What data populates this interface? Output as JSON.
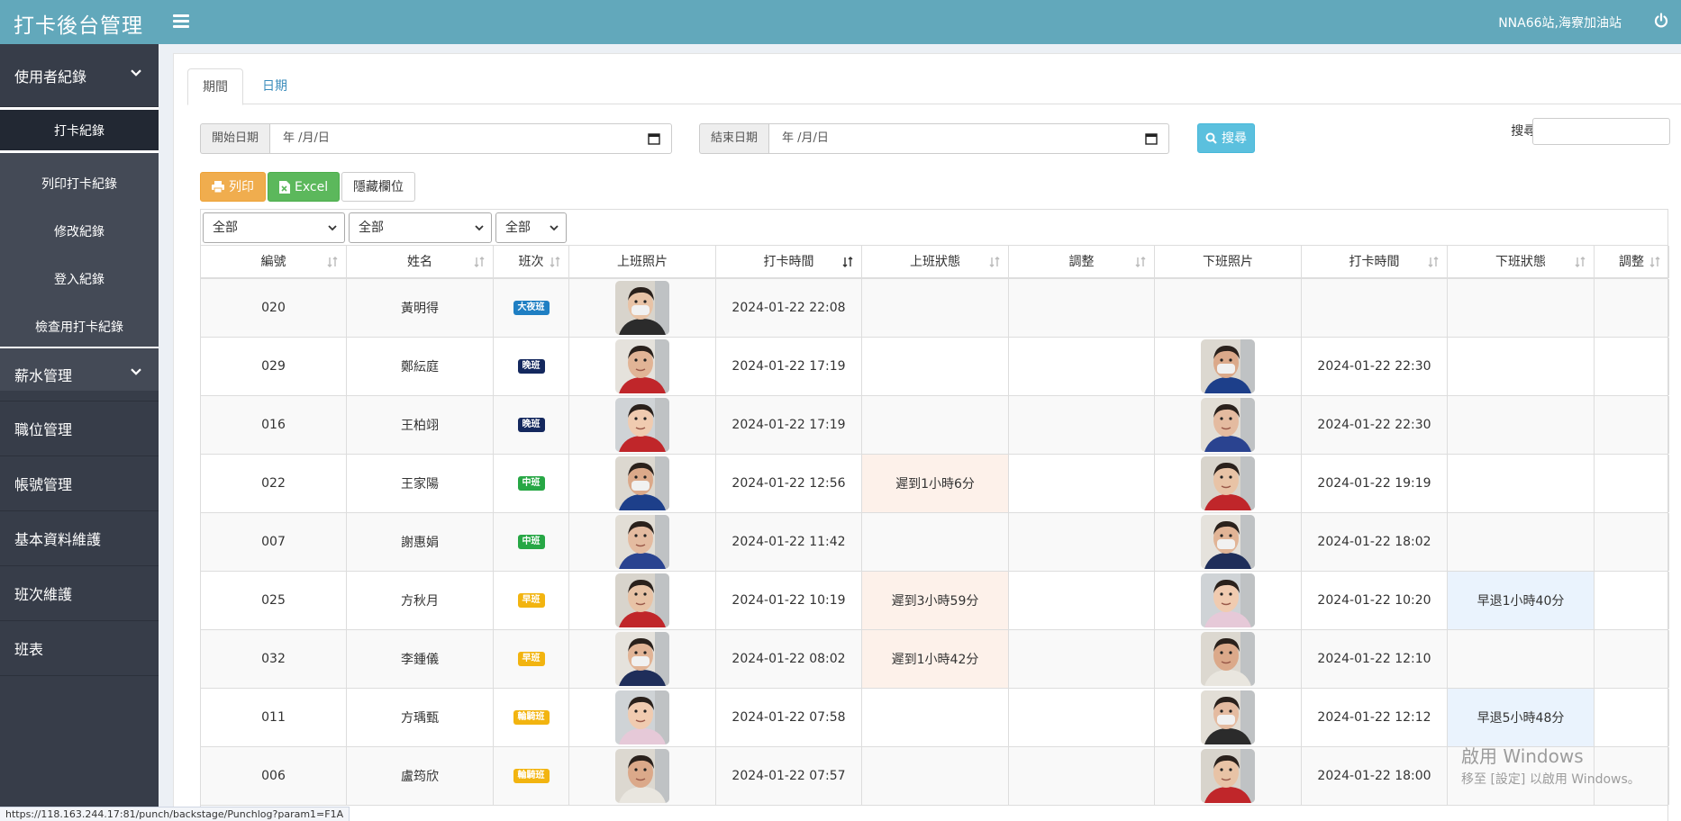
{
  "header": {
    "brand": "打卡後台管理",
    "station": "NNA66站,海寮加油站"
  },
  "sidebar": {
    "group1": "使用者紀錄",
    "sub": [
      "打卡紀錄",
      "列印打卡紀錄",
      "修改紀錄",
      "登入紀錄",
      "檢查用打卡紀錄"
    ],
    "group2": "薪水管理",
    "items": [
      "職位管理",
      "帳號管理",
      "基本資料維護",
      "班次維護",
      "班表"
    ]
  },
  "tabs": [
    "期間",
    "日期"
  ],
  "filters": {
    "start_label": "開始日期",
    "start_value": "年 /月/日",
    "end_label": "結束日期",
    "end_value": "年 /月/日",
    "search_btn": "搜尋"
  },
  "toolbar": {
    "print": "列印",
    "excel": "Excel",
    "hide_cols": "隱藏欄位",
    "search_label": "搜尋:"
  },
  "selects": [
    "全部",
    "全部",
    "全部"
  ],
  "columns": [
    "編號",
    "姓名",
    "班次",
    "上班照片",
    "打卡時間",
    "上班狀態",
    "調整",
    "下班照片",
    "打卡時間",
    "下班狀態",
    "調整"
  ],
  "colors": {
    "header": "#62a8bb",
    "sidebar": "#373d49",
    "shift_big_night": "#1f7fc3",
    "shift_night": "#14285e",
    "shift_middle": "#27a745",
    "shift_morning": "#f2b410",
    "shift_rotate": "#f2b410"
  },
  "rows": [
    {
      "id": "020",
      "name": "黃明得",
      "shift": "大夜班",
      "shift_color": "#1f7fc3",
      "in_photo": "photo-1",
      "in_time": "2024-01-22 22:08",
      "in_status": "",
      "in_adjust": "",
      "out_photo": "",
      "out_time": "",
      "out_status": "",
      "out_adjust": ""
    },
    {
      "id": "029",
      "name": "鄭紜庭",
      "shift": "晚班",
      "shift_color": "#14285e",
      "in_photo": "photo-2",
      "in_time": "2024-01-22 17:19",
      "in_status": "",
      "in_adjust": "",
      "out_photo": "photo-2b",
      "out_time": "2024-01-22 22:30",
      "out_status": "",
      "out_adjust": ""
    },
    {
      "id": "016",
      "name": "王柏翊",
      "shift": "晚班",
      "shift_color": "#14285e",
      "in_photo": "photo-3",
      "in_time": "2024-01-22 17:19",
      "in_status": "",
      "in_adjust": "",
      "out_photo": "photo-3b",
      "out_time": "2024-01-22 22:30",
      "out_status": "",
      "out_adjust": ""
    },
    {
      "id": "022",
      "name": "王家陽",
      "shift": "中班",
      "shift_color": "#27a745",
      "in_photo": "photo-4",
      "in_time": "2024-01-22 12:56",
      "in_status": "遲到1小時6分",
      "in_adjust": "",
      "out_photo": "photo-4b",
      "out_time": "2024-01-22 19:19",
      "out_status": "",
      "out_adjust": ""
    },
    {
      "id": "007",
      "name": "謝惠娟",
      "shift": "中班",
      "shift_color": "#27a745",
      "in_photo": "photo-5",
      "in_time": "2024-01-22 11:42",
      "in_status": "",
      "in_adjust": "",
      "out_photo": "photo-5b",
      "out_time": "2024-01-22 18:02",
      "out_status": "",
      "out_adjust": ""
    },
    {
      "id": "025",
      "name": "方秋月",
      "shift": "早班",
      "shift_color": "#f2b410",
      "in_photo": "photo-6",
      "in_time": "2024-01-22 10:19",
      "in_status": "遲到3小時59分",
      "in_adjust": "",
      "out_photo": "photo-6b",
      "out_time": "2024-01-22 10:20",
      "out_status": "早退1小時40分",
      "out_adjust": ""
    },
    {
      "id": "032",
      "name": "李鍾儀",
      "shift": "早班",
      "shift_color": "#f2b410",
      "in_photo": "photo-7",
      "in_time": "2024-01-22 08:02",
      "in_status": "遲到1小時42分",
      "in_adjust": "",
      "out_photo": "photo-7b",
      "out_time": "2024-01-22 12:10",
      "out_status": "",
      "out_adjust": ""
    },
    {
      "id": "011",
      "name": "方瑀甄",
      "shift": "輪騎班",
      "shift_color": "#f2b410",
      "in_photo": "photo-8",
      "in_time": "2024-01-22 07:58",
      "in_status": "",
      "in_adjust": "",
      "out_photo": "photo-8b",
      "out_time": "2024-01-22 12:12",
      "out_status": "早退5小時48分",
      "out_adjust": ""
    },
    {
      "id": "006",
      "name": "盧筠欣",
      "shift": "輪騎班",
      "shift_color": "#f2b410",
      "in_photo": "photo-9",
      "in_time": "2024-01-22 07:57",
      "in_status": "",
      "in_adjust": "",
      "out_photo": "photo-9b",
      "out_time": "2024-01-22 18:00",
      "out_status": "",
      "out_adjust": ""
    }
  ],
  "status_bar": "https://118.163.244.17:81/punch/backstage/Punchlog?param1=F1A",
  "watermark": {
    "line1": "啟用 Windows",
    "line2": "移至 [設定] 以啟用 Windows。"
  }
}
